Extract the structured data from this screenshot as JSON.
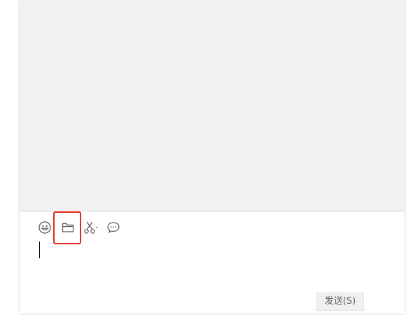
{
  "window": {
    "colors": {
      "message_bg": "#f1f1f1",
      "highlight": "#e3261c",
      "button_bg": "#f0f0f0"
    }
  },
  "toolbar": {
    "items": [
      {
        "name": "emoji",
        "icon": "emoji-icon"
      },
      {
        "name": "file",
        "icon": "folder-icon"
      },
      {
        "name": "screenshot",
        "icon": "scissors-icon"
      },
      {
        "name": "chat-history",
        "icon": "chat-bubble-icon"
      }
    ]
  },
  "composer": {
    "text": ""
  },
  "send": {
    "label": "发送(S)"
  }
}
